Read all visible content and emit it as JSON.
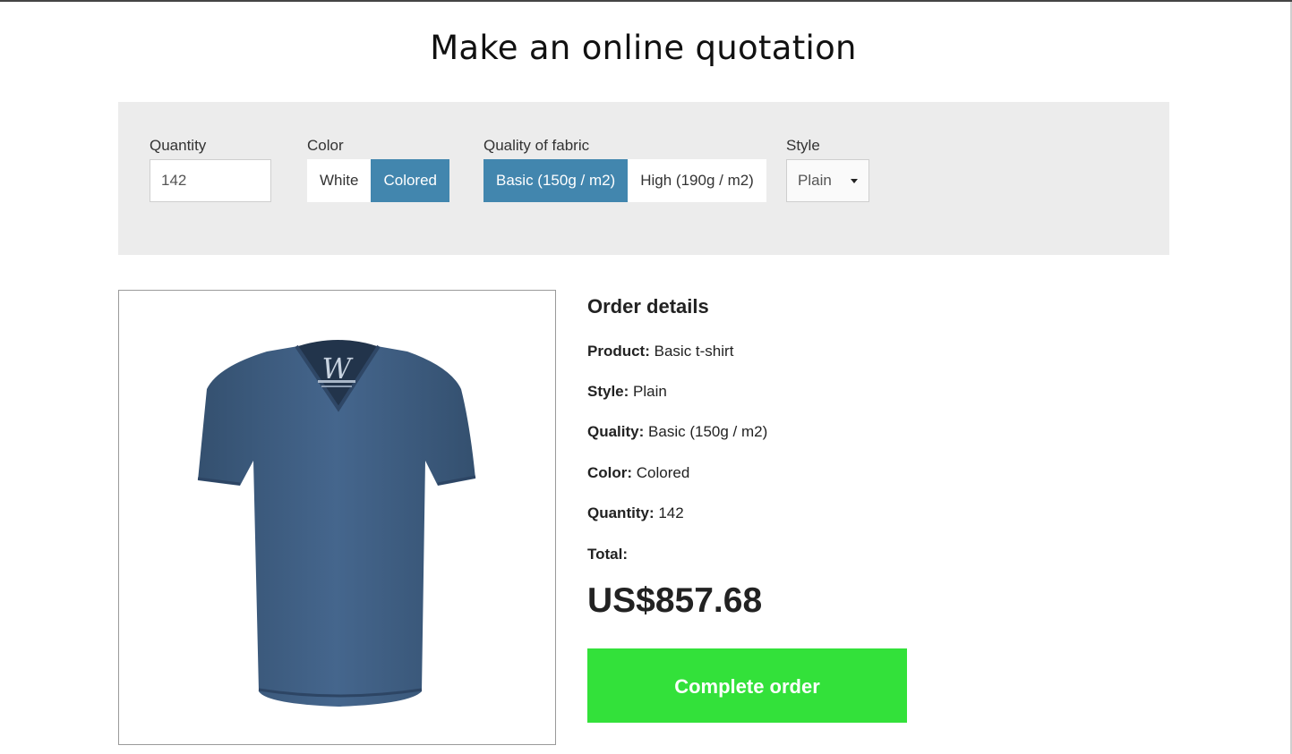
{
  "page": {
    "title": "Make an online quotation"
  },
  "options": {
    "quantity": {
      "label": "Quantity",
      "value": "142"
    },
    "color": {
      "label": "Color",
      "options": [
        {
          "label": "White",
          "selected": false
        },
        {
          "label": "Colored",
          "selected": true
        }
      ]
    },
    "quality": {
      "label": "Quality of fabric",
      "options": [
        {
          "label": "Basic (150g / m2)",
          "selected": true
        },
        {
          "label": "High (190g / m2)",
          "selected": false
        }
      ]
    },
    "style": {
      "label": "Style",
      "value": "Plain"
    }
  },
  "product_image": {
    "icon": "tshirt-image",
    "shirt_color": "#3f5c82",
    "tag_letter": "W"
  },
  "order_details": {
    "heading": "Order details",
    "product": {
      "label": "Product:",
      "value": "Basic t-shirt"
    },
    "style": {
      "label": "Style:",
      "value": "Plain"
    },
    "quality": {
      "label": "Quality:",
      "value": "Basic (150g / m2)"
    },
    "color": {
      "label": "Color:",
      "value": "Colored"
    },
    "quantity": {
      "label": "Quantity:",
      "value": "142"
    },
    "total": {
      "label": "Total:",
      "value": "US$857.68"
    }
  },
  "actions": {
    "complete_label": "Complete order"
  },
  "colors": {
    "accent": "#4286ae",
    "panel_bg": "#ececec",
    "complete_button": "#33e13a"
  }
}
